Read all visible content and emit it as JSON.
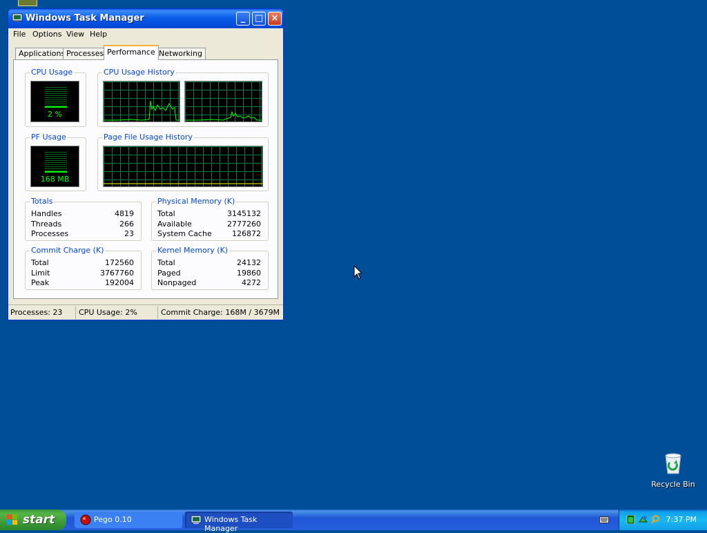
{
  "window": {
    "title": "Windows Task Manager",
    "controls": {
      "minimize": "_",
      "maximize": "□",
      "close": "×"
    }
  },
  "menu": [
    "File",
    "Options",
    "View",
    "Help"
  ],
  "tabs": [
    "Applications",
    "Processes",
    "Performance",
    "Networking"
  ],
  "active_tab": "Performance",
  "performance": {
    "cpu_usage": {
      "title": "CPU Usage",
      "value": "2 %",
      "level": 0.02
    },
    "cpu_history": {
      "title": "CPU Usage History"
    },
    "pf_usage": {
      "title": "PF Usage",
      "value": "168 MB",
      "level": 0.05
    },
    "pf_history": {
      "title": "Page File Usage History"
    },
    "totals": {
      "title": "Totals",
      "rows": [
        {
          "label": "Handles",
          "value": "4819"
        },
        {
          "label": "Threads",
          "value": "266"
        },
        {
          "label": "Processes",
          "value": "23"
        }
      ]
    },
    "physical_memory": {
      "title": "Physical Memory (K)",
      "rows": [
        {
          "label": "Total",
          "value": "3145132"
        },
        {
          "label": "Available",
          "value": "2777260"
        },
        {
          "label": "System Cache",
          "value": "126872"
        }
      ]
    },
    "commit_charge": {
      "title": "Commit Charge (K)",
      "rows": [
        {
          "label": "Total",
          "value": "172560"
        },
        {
          "label": "Limit",
          "value": "3767760"
        },
        {
          "label": "Peak",
          "value": "192004"
        }
      ]
    },
    "kernel_memory": {
      "title": "Kernel Memory (K)",
      "rows": [
        {
          "label": "Total",
          "value": "24132"
        },
        {
          "label": "Paged",
          "value": "19860"
        },
        {
          "label": "Nonpaged",
          "value": "4272"
        }
      ]
    }
  },
  "statusbar": {
    "processes": "Processes: 23",
    "cpu": "CPU Usage: 2%",
    "commit": "Commit Charge: 168M / 3679M"
  },
  "desktop": {
    "recycle_bin": "Recycle Bin"
  },
  "taskbar": {
    "start": "start",
    "tasks": [
      "Pego 0.10",
      "Windows Task Manager"
    ],
    "clock": "7:37 PM"
  },
  "colors": {
    "desktop": "#004e98",
    "graph_line": "#00ff00",
    "group_title": "#0046d5"
  }
}
